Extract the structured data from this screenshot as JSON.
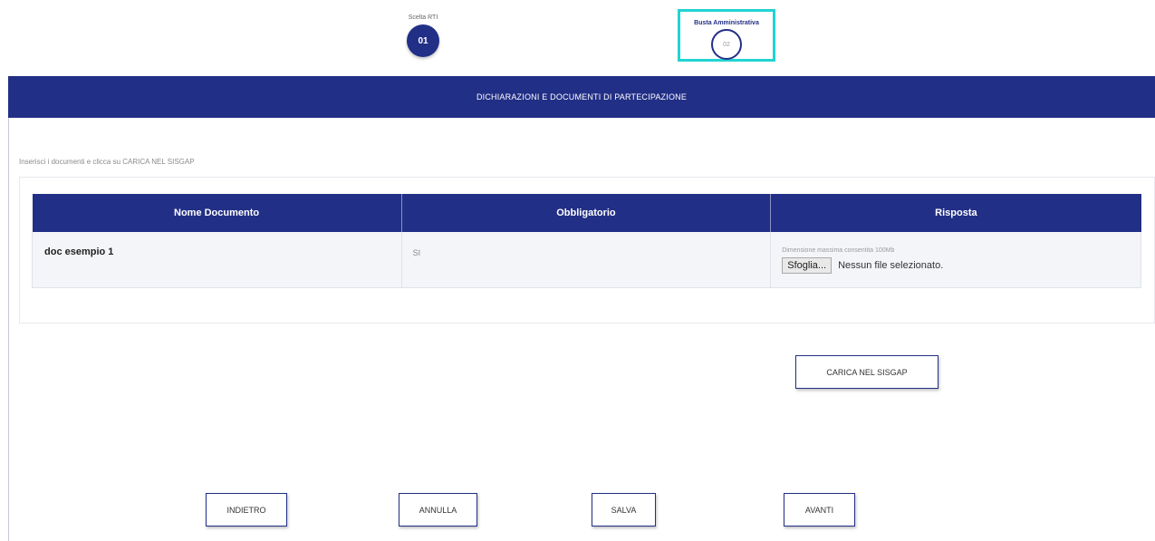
{
  "stepper": {
    "steps": [
      {
        "label": "Scelta RTI",
        "number": "01"
      },
      {
        "label": "Busta Amministrativa",
        "number": "02"
      }
    ]
  },
  "section": {
    "title": "DICHIARAZIONI E DOCUMENTI DI PARTECIPAZIONE",
    "instruction": "Inserisci i documenti e clicca su CARICA NEL SISGAP"
  },
  "table": {
    "headers": [
      "Nome Documento",
      "Obbligatorio",
      "Risposta"
    ],
    "rows": [
      {
        "name": "doc esempio 1",
        "mandatory": "SI",
        "size_note": "Dimensione massima consentita 100Mb",
        "browse_label": "Sfoglia...",
        "file_status": "Nessun file selezionato."
      }
    ]
  },
  "actions": {
    "upload": "CARICA NEL SISGAP",
    "back": "INDIETRO",
    "cancel": "ANNULLA",
    "save": "SALVA",
    "next": "AVANTI"
  },
  "colors": {
    "primary": "#222f86",
    "highlight": "#22d3d3"
  }
}
